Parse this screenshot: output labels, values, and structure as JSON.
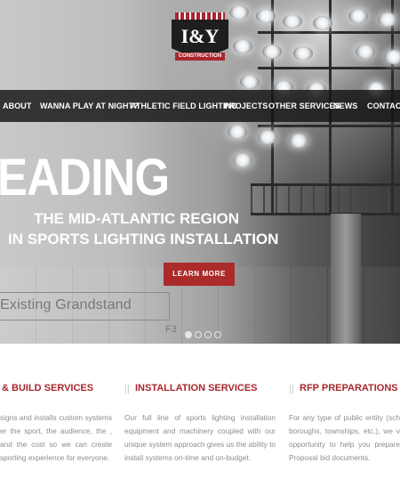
{
  "logo": {
    "mark": "I&Y",
    "sub": "CONSTRUCTION"
  },
  "nav": {
    "items": [
      "ABOUT",
      "WANNA PLAY AT NIGHT?",
      "ATHLETIC FIELD LIGHTING",
      "PROJECTS",
      "OTHER SERVICES",
      "NEWS",
      "CONTACT U"
    ]
  },
  "hero": {
    "headline": "EADING",
    "sub1": "THE MID-ATLANTIC REGION",
    "sub2": "IN SPORTS LIGHTING INSTALLATION",
    "button": "LEARN MORE",
    "blueprint_label": "Existing Grandstand",
    "blueprint_code": "F3",
    "slides": 4,
    "active_slide": 1
  },
  "services": [
    {
      "title": "& BUILD SERVICES",
      "text": "signs and installs custom systems er the sport, the audience, the , and the cost so we can create sporting experience for everyone."
    },
    {
      "title": "INSTALLATION SERVICES",
      "text": "Our full line of sports lighting installation equipment and machinery coupled with our unique system approach gives us the ability to install systems on-time and on-budget."
    },
    {
      "title": "RFP PREPARATIONS",
      "text": "For any type of public entity (sch boroughs, townships, etc.), we v opportunity to help you prepare Proposal bid documents."
    }
  ],
  "colors": {
    "accent": "#a8272d",
    "nav_bg": "#141414"
  }
}
